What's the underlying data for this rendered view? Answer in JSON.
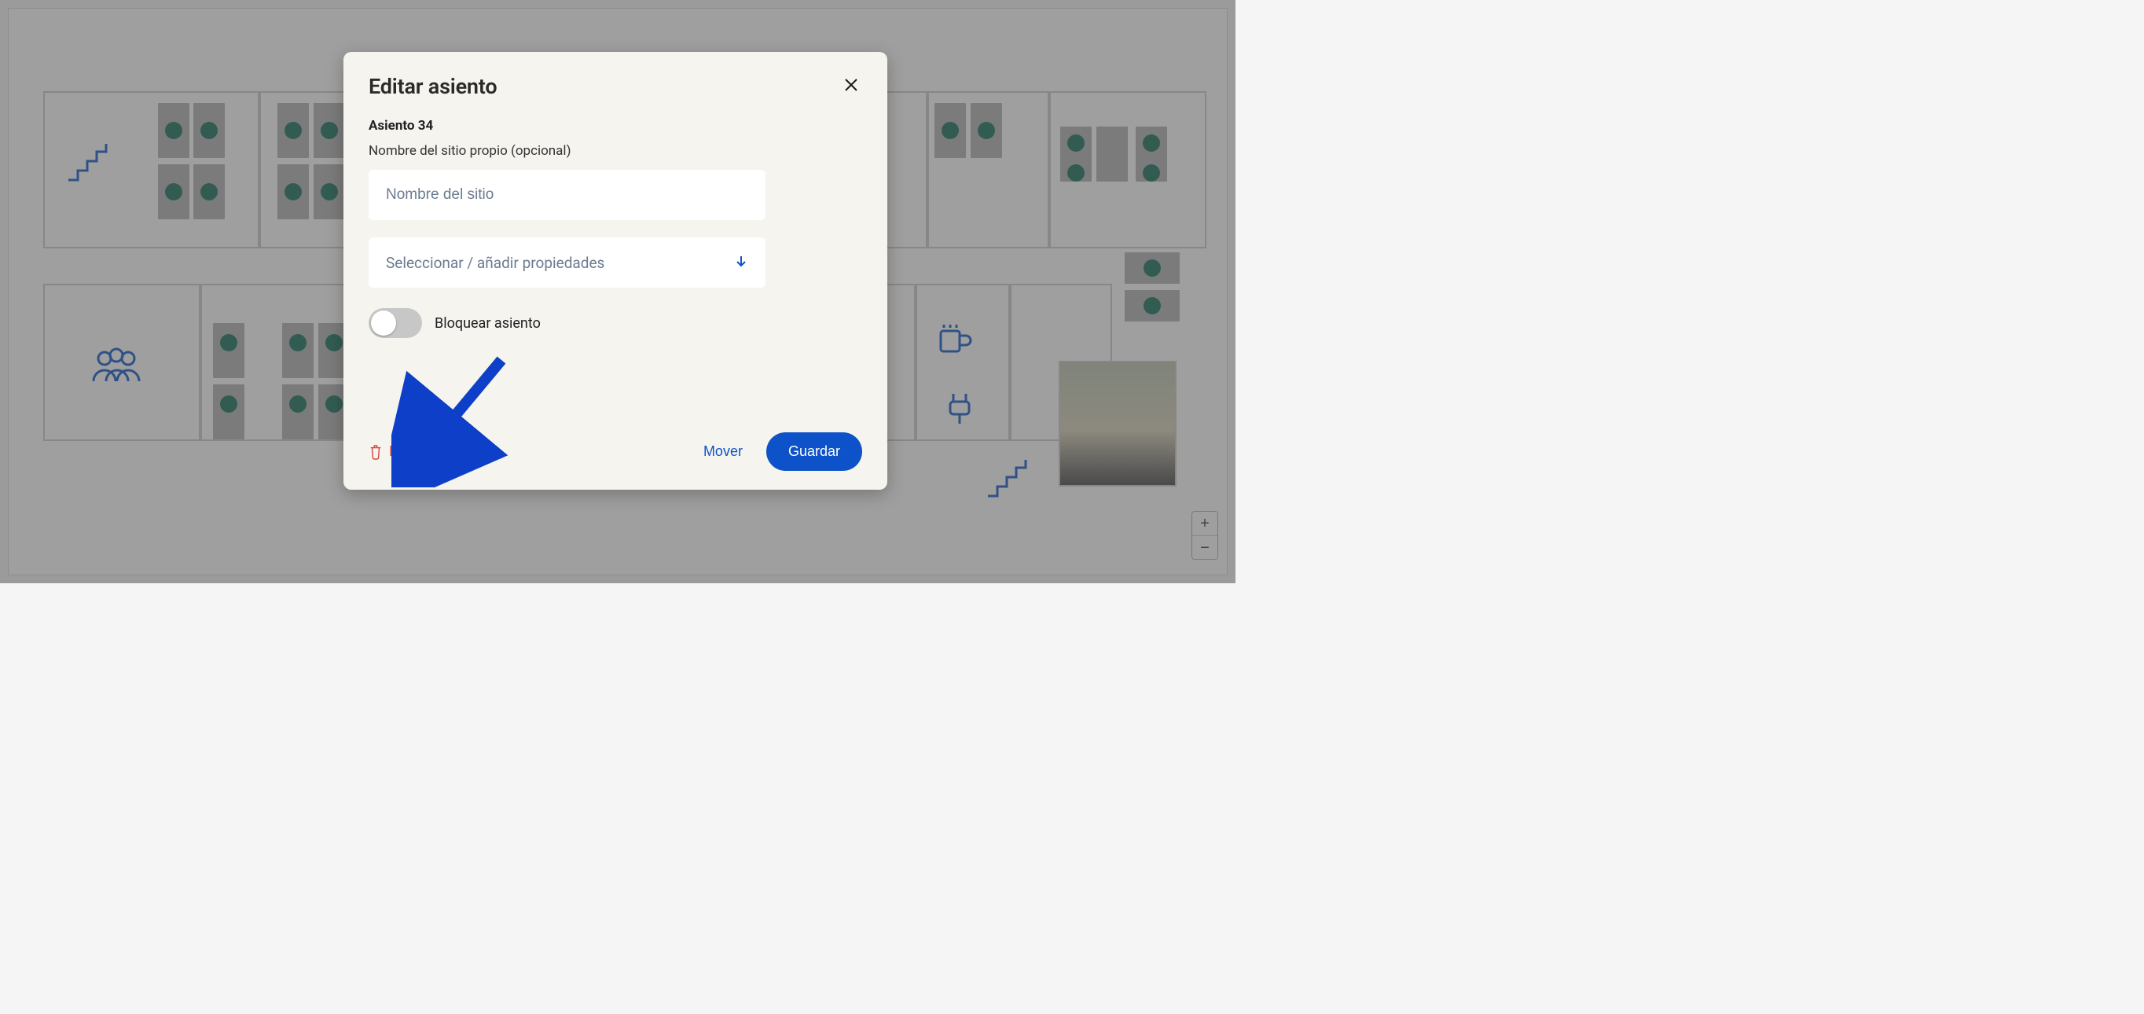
{
  "modal": {
    "title": "Editar asiento",
    "seat_label": "Asiento 34",
    "name_field_label": "Nombre del sitio propio (opcional)",
    "name_placeholder": "Nombre del sitio",
    "properties_placeholder": "Seleccionar / añadir propiedades",
    "lock_label": "Bloquear asiento",
    "locked": false,
    "delete_label": "Borrar",
    "move_label": "Mover",
    "save_label": "Guardar"
  },
  "zoom": {
    "in": "+",
    "out": "−"
  },
  "colors": {
    "primary": "#0d52c8",
    "danger": "#d34a3f",
    "seat": "#0f6b55"
  },
  "annotations": {
    "arrow_target": "delete-button"
  }
}
